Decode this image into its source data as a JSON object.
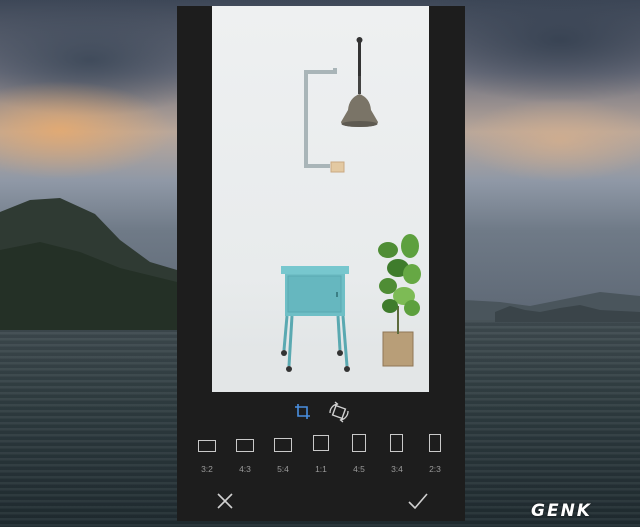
{
  "editor": {
    "tools": [
      {
        "icon": "crop-icon",
        "active": true
      },
      {
        "icon": "rotate-icon",
        "active": false
      }
    ],
    "aspect_ratios": [
      {
        "label": "3:2"
      },
      {
        "label": "4:3"
      },
      {
        "label": "5:4"
      },
      {
        "label": "1:1"
      },
      {
        "label": "4:5"
      },
      {
        "label": "3:4"
      },
      {
        "label": "2:3"
      }
    ],
    "actions": {
      "cancel_icon": "close-icon",
      "confirm_icon": "checkmark-icon"
    },
    "accent_color": "#4a8fe0"
  },
  "watermark": {
    "text": "GENK"
  }
}
